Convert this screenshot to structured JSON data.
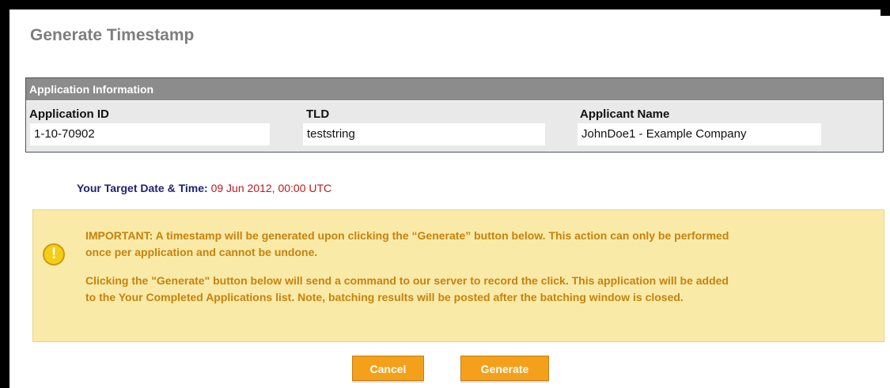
{
  "page": {
    "title": "Generate Timestamp"
  },
  "application_info": {
    "header": "Application Information",
    "fields": [
      {
        "label": "Application ID",
        "value": "1-10-70902"
      },
      {
        "label": "TLD",
        "value": "teststring"
      },
      {
        "label": "Applicant Name",
        "value": "JohnDoe1 - Example Company"
      }
    ]
  },
  "target": {
    "label": "Your Target Date & Time:",
    "value": "09 Jun 2012, 00:00 UTC"
  },
  "notice": {
    "icon": "exclamation-icon",
    "paragraph1_line1": "IMPORTANT: A timestamp will be generated upon clicking the “Generate” button below. This action can only be performed",
    "paragraph1_line2": "once per application and cannot be undone.",
    "paragraph2_line1": "Clicking the \"Generate\" button below will send a command to our server to record the click. This application will be added",
    "paragraph2_line2": "to the Your Completed Applications list. Note, batching results will be posted after the batching window is closed."
  },
  "buttons": {
    "cancel_label": "Cancel",
    "generate_label": "Generate"
  },
  "colors": {
    "accent_orange": "#f5a01b",
    "target_red": "#c0181c",
    "label_navy": "#1f2272",
    "notice_bg": "#faeaa8",
    "notice_text": "#c7820c"
  }
}
